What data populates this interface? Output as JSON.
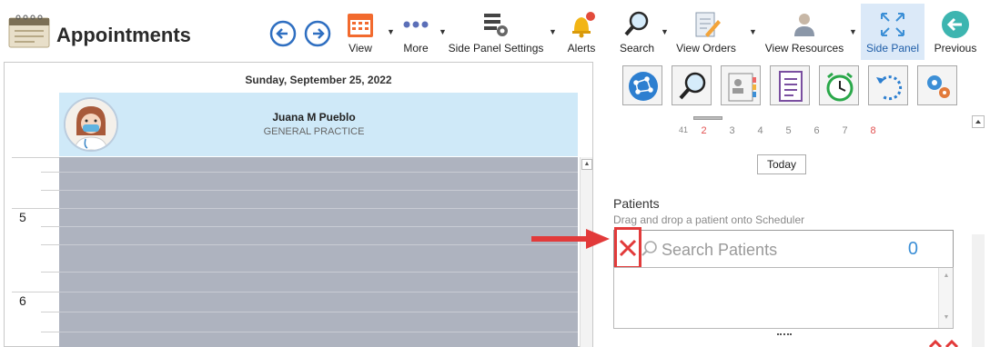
{
  "app": {
    "title": "Appointments"
  },
  "toolbar": {
    "items": [
      {
        "label": "View",
        "icon": "calendar-icon",
        "dropdown": true
      },
      {
        "label": "More",
        "icon": "ellipsis-icon",
        "dropdown": true
      },
      {
        "label": "Side Panel Settings",
        "icon": "settings-list-icon",
        "dropdown": true
      },
      {
        "label": "Alerts",
        "icon": "bell-icon",
        "dropdown": false
      },
      {
        "label": "Search",
        "icon": "magnifier-icon",
        "dropdown": true
      },
      {
        "label": "View Orders",
        "icon": "orders-icon",
        "dropdown": true
      },
      {
        "label": "View Resources",
        "icon": "resources-icon",
        "dropdown": true
      },
      {
        "label": "Side Panel",
        "icon": "expand-icon",
        "active": true
      },
      {
        "label": "Previous",
        "icon": "back-icon"
      }
    ]
  },
  "scheduler": {
    "date": "Sunday, September 25, 2022",
    "provider": {
      "name": "Juana M Pueblo",
      "specialty": "GENERAL PRACTICE"
    },
    "time_labels": [
      "5",
      "6"
    ]
  },
  "side_panel": {
    "buttons": [
      "network-icon",
      "search-icon",
      "contact-card-icon",
      "checklist-icon",
      "alarm-clock-icon",
      "refresh-icon",
      "gears-icon"
    ],
    "calendar_days": [
      "41",
      "2",
      "3",
      "4",
      "5",
      "6",
      "7",
      "8"
    ],
    "today_label": "Today",
    "patients": {
      "title": "Patients",
      "hint": "Drag and drop a patient onto Scheduler",
      "search_placeholder": "Search Patients",
      "count": "0"
    }
  },
  "colors": {
    "accent": "#3c8fd6",
    "provider_bg": "#cfe9f8",
    "grid_bg": "#aeb3bf",
    "callout": "#e23a3a"
  }
}
